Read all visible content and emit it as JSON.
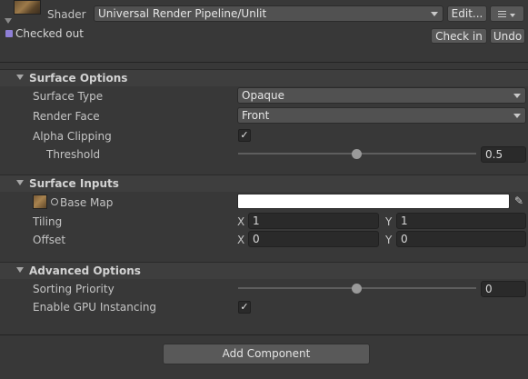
{
  "header": {
    "shader_label": "Shader",
    "shader_value": "Universal Render Pipeline/Unlit",
    "edit_label": "Edit...",
    "menu_icon": "list-icon",
    "checked_out_label": "Checked out",
    "check_in_label": "Check in",
    "undo_label": "Undo"
  },
  "surface_options": {
    "title": "Surface Options",
    "surface_type_label": "Surface Type",
    "surface_type_value": "Opaque",
    "render_face_label": "Render Face",
    "render_face_value": "Front",
    "alpha_clipping_label": "Alpha Clipping",
    "alpha_clipping_checked": true,
    "threshold_label": "Threshold",
    "threshold_value": "0.5"
  },
  "surface_inputs": {
    "title": "Surface Inputs",
    "base_map_label": "Base Map",
    "base_map_color": "#ffffff",
    "tiling_label": "Tiling",
    "tiling_x_label": "X",
    "tiling_x": "1",
    "tiling_y_label": "Y",
    "tiling_y": "1",
    "offset_label": "Offset",
    "offset_x_label": "X",
    "offset_x": "0",
    "offset_y_label": "Y",
    "offset_y": "0"
  },
  "advanced_options": {
    "title": "Advanced Options",
    "sorting_priority_label": "Sorting Priority",
    "sorting_priority_value": "0",
    "gpu_instancing_label": "Enable GPU Instancing",
    "gpu_instancing_checked": true
  },
  "footer": {
    "add_component_label": "Add Component"
  },
  "colors": {
    "background": "#383838",
    "checked_out_badge": "#8e7fd6"
  }
}
